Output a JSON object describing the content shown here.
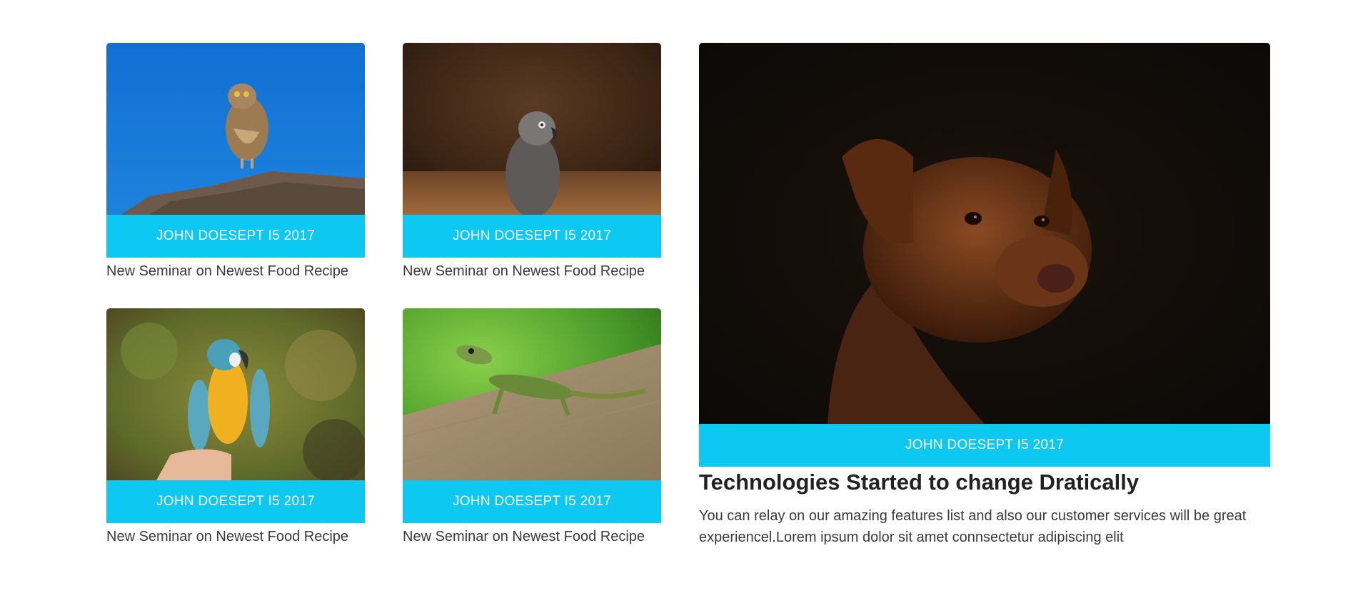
{
  "cards": [
    {
      "image": "owl-photo",
      "meta": "JOHN DOESEPT I5 2017",
      "caption": "New Seminar on Newest Food Recipe"
    },
    {
      "image": "grey-parrot-photo",
      "meta": "JOHN DOESEPT I5 2017",
      "caption": "New Seminar on Newest Food Recipe"
    },
    {
      "image": "macaw-photo",
      "meta": "JOHN DOESEPT I5 2017",
      "caption": "New Seminar on Newest Food Recipe"
    },
    {
      "image": "lizard-photo",
      "meta": "JOHN DOESEPT I5 2017",
      "caption": "New Seminar on Newest Food Recipe"
    }
  ],
  "featured": {
    "image": "dog-photo",
    "meta": "JOHN DOESEPT I5 2017",
    "title": "Technologies Started to change Dratically",
    "text": "You can relay on our amazing features list and also our customer services will be great experiencel.Lorem ipsum dolor sit amet connsectetur adipiscing elit"
  },
  "colors": {
    "meta_bar": "#0dc8f0",
    "text": "#3a3a3a",
    "title": "#222222"
  }
}
